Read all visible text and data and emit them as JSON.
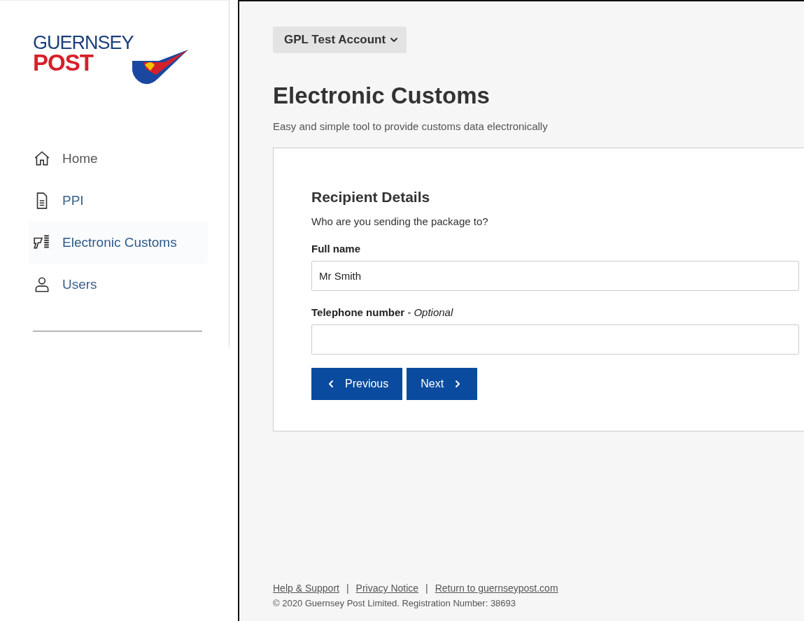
{
  "logo": {
    "line_1": "GUERNSEY",
    "line_2": "POST"
  },
  "nav": [
    {
      "label": "Home",
      "kind": "home",
      "selected": false
    },
    {
      "label": "PPI",
      "kind": "document",
      "selected": false
    },
    {
      "label": "Electronic Customs",
      "kind": "scanner",
      "selected": true
    },
    {
      "label": "Users",
      "kind": "user",
      "selected": false
    }
  ],
  "account_menu": {
    "label": "GPL Test Account"
  },
  "page": {
    "title": "Electronic Customs",
    "subtitle": "Easy and simple tool to provide customs data electronically"
  },
  "form": {
    "heading": "Recipient Details",
    "question": "Who are you sending the package to?",
    "fields": [
      {
        "label": "Full name",
        "value": "Mr Smith"
      },
      {
        "label": "Telephone number",
        "note": "- Optional"
      }
    ],
    "buttons": [
      {
        "label": "Previous",
        "kind": "previous"
      },
      {
        "label": "Next",
        "kind": "next"
      }
    ]
  },
  "footer": {
    "links": [
      "Help & Support",
      "Privacy Notice",
      "Return to guernseypost.com"
    ],
    "separator": "|",
    "copyright": "© 2020 Guernsey Post Limited. Registration Number: 38693"
  }
}
